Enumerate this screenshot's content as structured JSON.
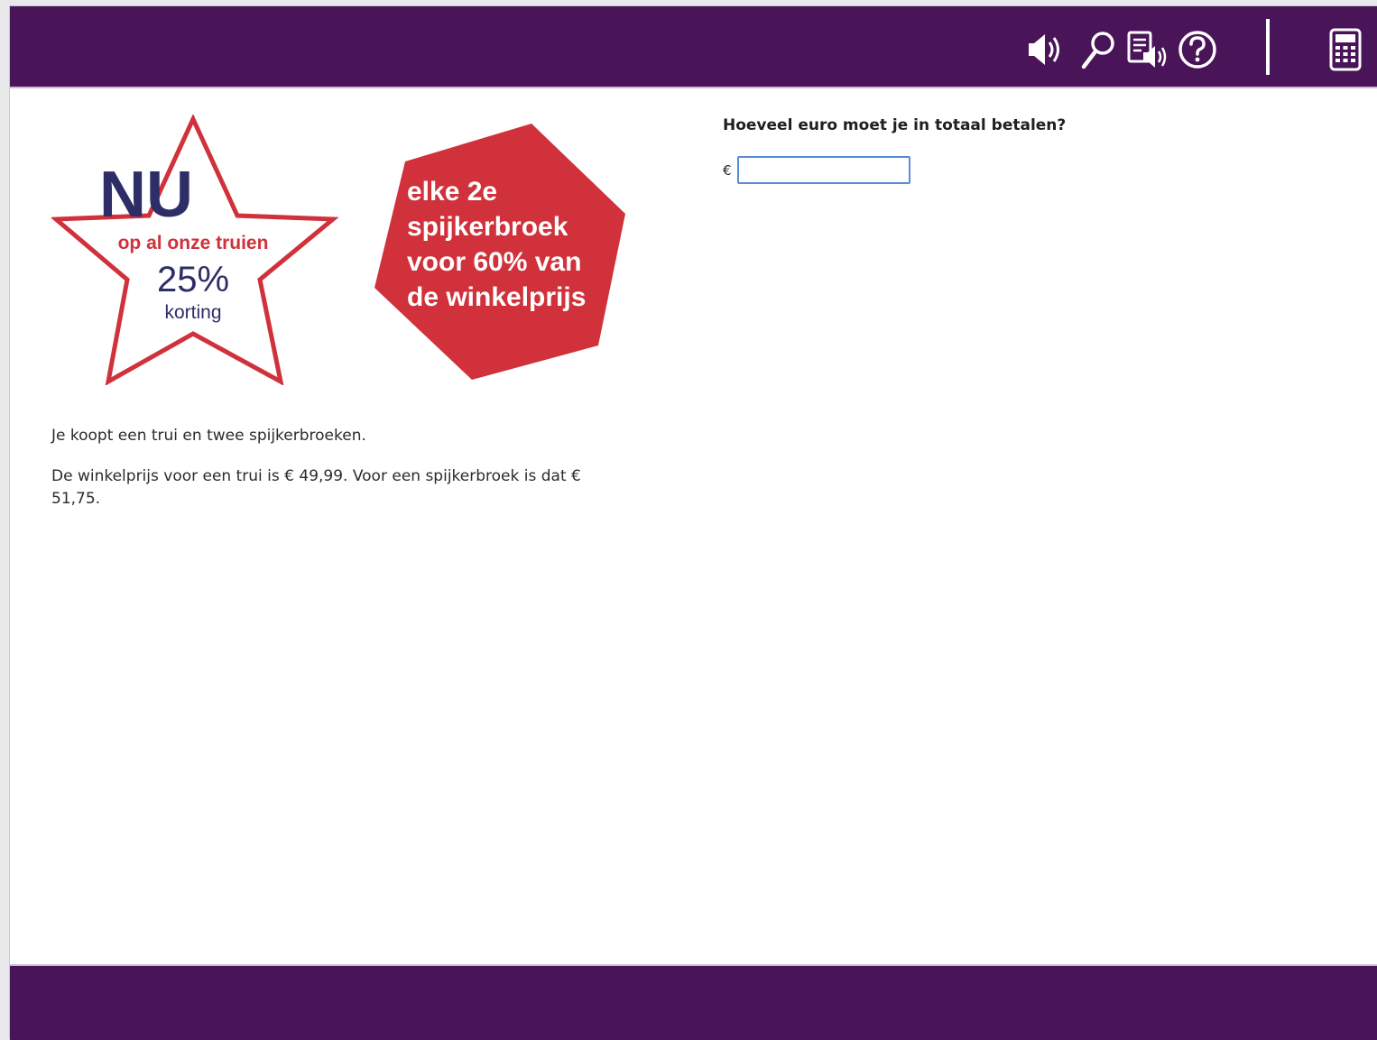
{
  "toolbar": {
    "icons": [
      "speaker-icon",
      "magnifier-icon",
      "read-aloud-icon",
      "help-icon",
      "calculator-icon"
    ],
    "bar_color": "#4a1458"
  },
  "promo": {
    "star": {
      "big": "NU",
      "line1": "op al onze truien",
      "percent": "25%",
      "line2": "korting",
      "outline_color": "#d0313b",
      "text_color": "#2d2e67"
    },
    "hex": {
      "lines": [
        "elke 2e",
        "spijkerbroek",
        "voor 60% van",
        "de winkelprijs"
      ],
      "fill_color": "#d0313b"
    }
  },
  "scenario": {
    "p1": "Je koopt een trui en twee spijkerbroeken.",
    "p2": "De winkelprijs voor een trui is € 49,99. Voor een spijkerbroek is dat € 51,75."
  },
  "question": {
    "text": "Hoeveel euro moet je in totaal betalen?",
    "currency": "€",
    "answer_value": ""
  }
}
